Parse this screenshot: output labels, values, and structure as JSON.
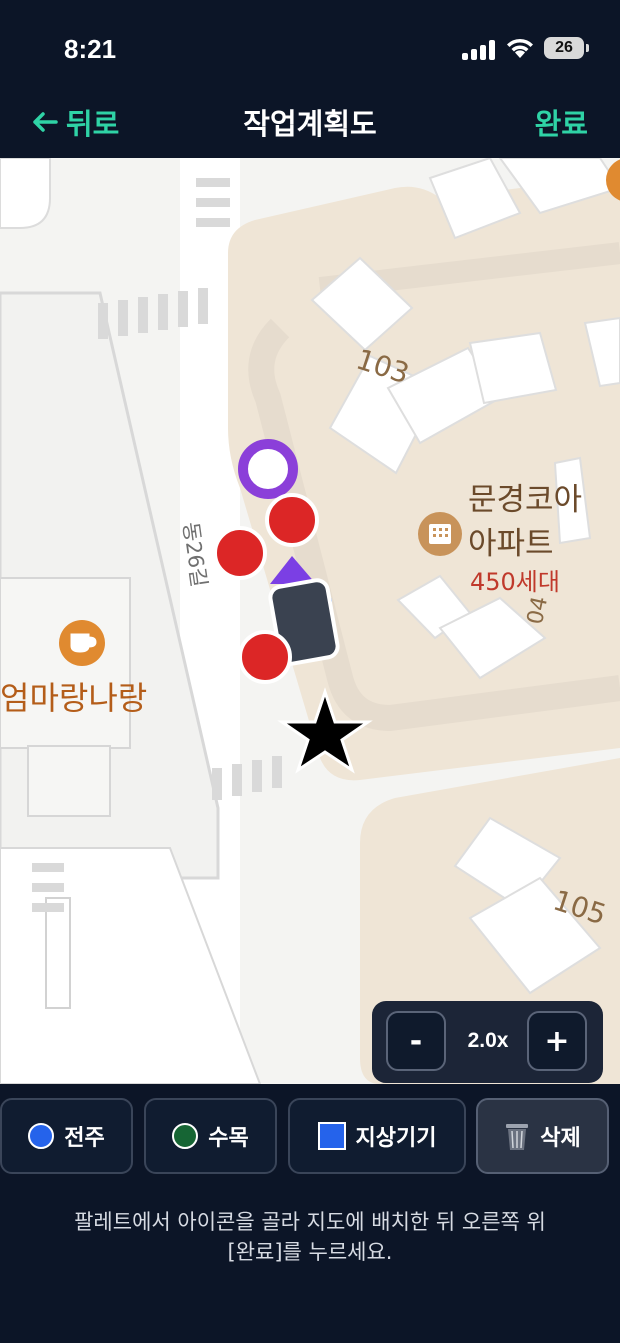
{
  "status": {
    "time": "8:21",
    "battery": "26"
  },
  "nav": {
    "back_label": "뒤로",
    "title": "작업계획도",
    "done_label": "완료"
  },
  "map": {
    "labels": {
      "bldg_103": "103",
      "bldg_105": "105",
      "bldg_104": "04",
      "apt_name_1": "문경코아",
      "apt_name_2": "아파트",
      "apt_units": "450세대",
      "cafe": "엄마랑나랑",
      "road": "동26길"
    },
    "colors": {
      "pole": "#dc2626",
      "selected_ring": "#8b3fd9",
      "equipment": "#3a4250",
      "star": "#000000"
    }
  },
  "zoom": {
    "minus": "-",
    "level": "2.0x",
    "plus": "+"
  },
  "palette": {
    "pole": "전주",
    "tree": "수목",
    "ground_equipment": "지상기기",
    "delete": "삭제"
  },
  "help": {
    "line1": "팔레트에서 아이콘을 골라 지도에 배치한 뒤 오른쪽 위",
    "line2": "[완료]를 누르세요."
  }
}
